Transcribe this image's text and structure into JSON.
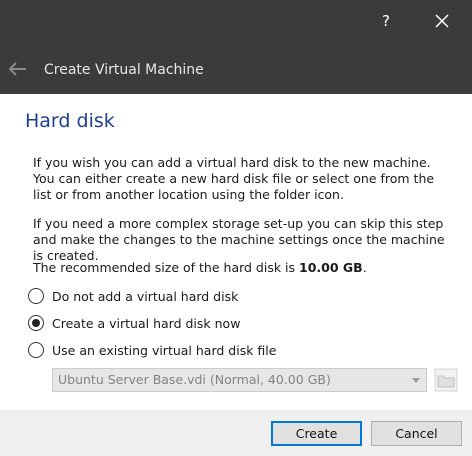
{
  "titlebar": {
    "help_glyph": "?",
    "window_title": "Create Virtual Machine"
  },
  "page": {
    "title": "Hard disk",
    "paragraph1": "If you wish you can add a virtual hard disk to the new machine. You can either create a new hard disk file or select one from the list or from another location using the folder icon.",
    "paragraph2": "If you need a more complex storage set-up you can skip this step and make the changes to the machine settings once the machine is created.",
    "recommended_prefix": "The recommended size of the hard disk is ",
    "recommended_size": "10.00 GB",
    "recommended_suffix": "."
  },
  "options": [
    {
      "label": "Do not add a virtual hard disk",
      "checked": false
    },
    {
      "label": "Create a virtual hard disk now",
      "checked": true
    },
    {
      "label": "Use an existing virtual hard disk file",
      "checked": false
    }
  ],
  "disk_select": {
    "value": "Ubuntu Server Base.vdi (Normal, 40.00 GB)",
    "enabled": false
  },
  "buttons": {
    "create": "Create",
    "cancel": "Cancel"
  },
  "icons": {
    "back": "arrow-left-icon",
    "close": "close-icon",
    "folder": "folder-icon",
    "dropdown": "chevron-down-icon"
  },
  "colors": {
    "titlebar_bg": "#3b3b3b",
    "title_blue": "#1c3f94",
    "default_button_border": "#0078d7"
  }
}
